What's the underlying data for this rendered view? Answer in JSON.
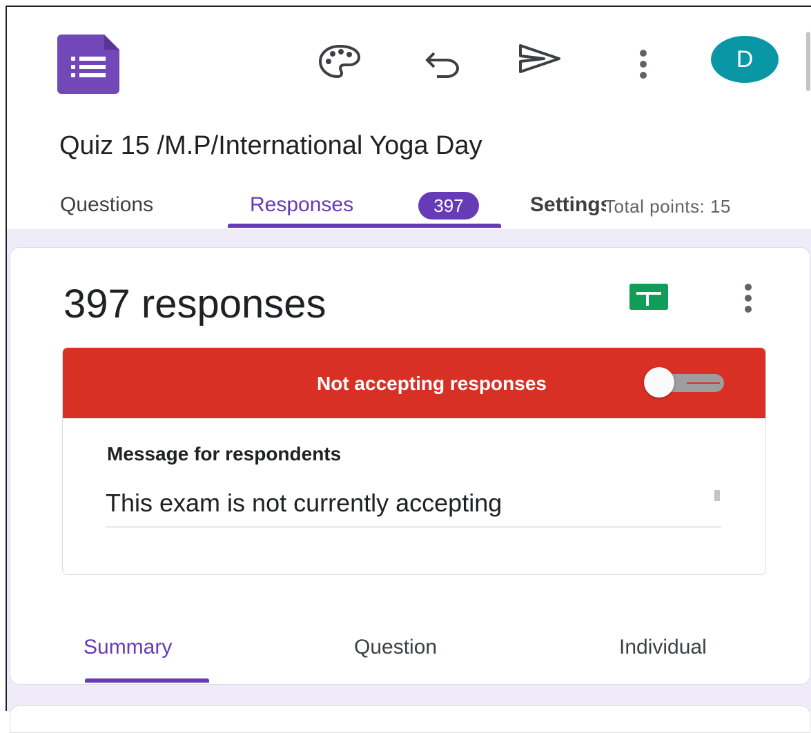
{
  "app": {
    "logo_icon": "google-forms-icon",
    "avatar_letter": "D",
    "avatar_color": "#0a97a5",
    "accent_color": "#673ab7",
    "toolbar_icons": [
      "palette-icon",
      "undo-icon",
      "send-icon",
      "more-vert-icon"
    ]
  },
  "document": {
    "title": "Quiz 15 /M.P/International Yoga Day"
  },
  "tabs": {
    "questions": "Questions",
    "responses": "Responses",
    "responses_badge": "397",
    "settings": "Settings",
    "total_points": "Total points: 15",
    "active": "Responses"
  },
  "responses_card": {
    "count_text": "397 responses",
    "sheets_icon": "google-sheets-icon",
    "banner_text": "Not accepting responses",
    "banner_color": "#d93025",
    "accepting": false,
    "message_label": "Message for respondents",
    "message_value": "This exam is not currently accepting"
  },
  "sub_tabs": {
    "summary": "Summary",
    "question": "Question",
    "individual": "Individual",
    "active": "Summary"
  }
}
